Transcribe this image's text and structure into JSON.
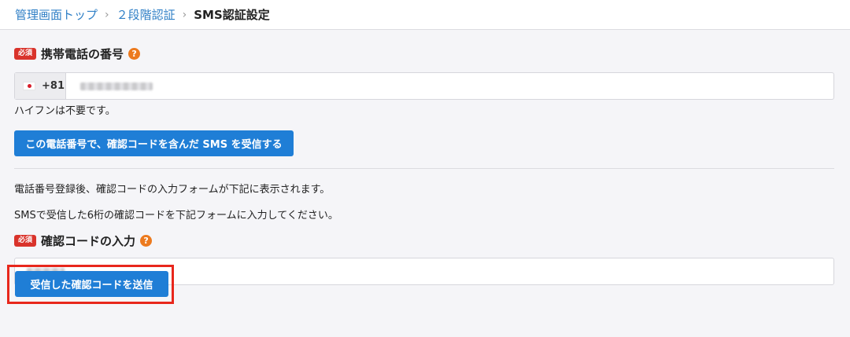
{
  "breadcrumb": {
    "items": [
      "管理画面トップ",
      "２段階認証"
    ],
    "current": "SMS認証設定",
    "separator": "›"
  },
  "phone": {
    "required_badge": "必須",
    "label": "携帯電話の番号",
    "help": "?",
    "country_code": "+81",
    "value": "",
    "hint": "ハイフンは不要です。",
    "send_button": "この電話番号で、確認コードを含んだ SMS を受信する"
  },
  "instructions": [
    "電話番号登録後、確認コードの入力フォームが下記に表示されます。",
    "SMSで受信した6桁の確認コードを下記フォームに入力してください。"
  ],
  "code": {
    "required_badge": "必須",
    "label": "確認コードの入力",
    "help": "?",
    "value": "",
    "submit_button": "受信した確認コードを送信"
  },
  "colors": {
    "link": "#2f7fc6",
    "primary_button": "#1f7ed6",
    "required_badge": "#d9332b",
    "help_icon": "#ec7a1e",
    "highlight": "#e8271c"
  }
}
